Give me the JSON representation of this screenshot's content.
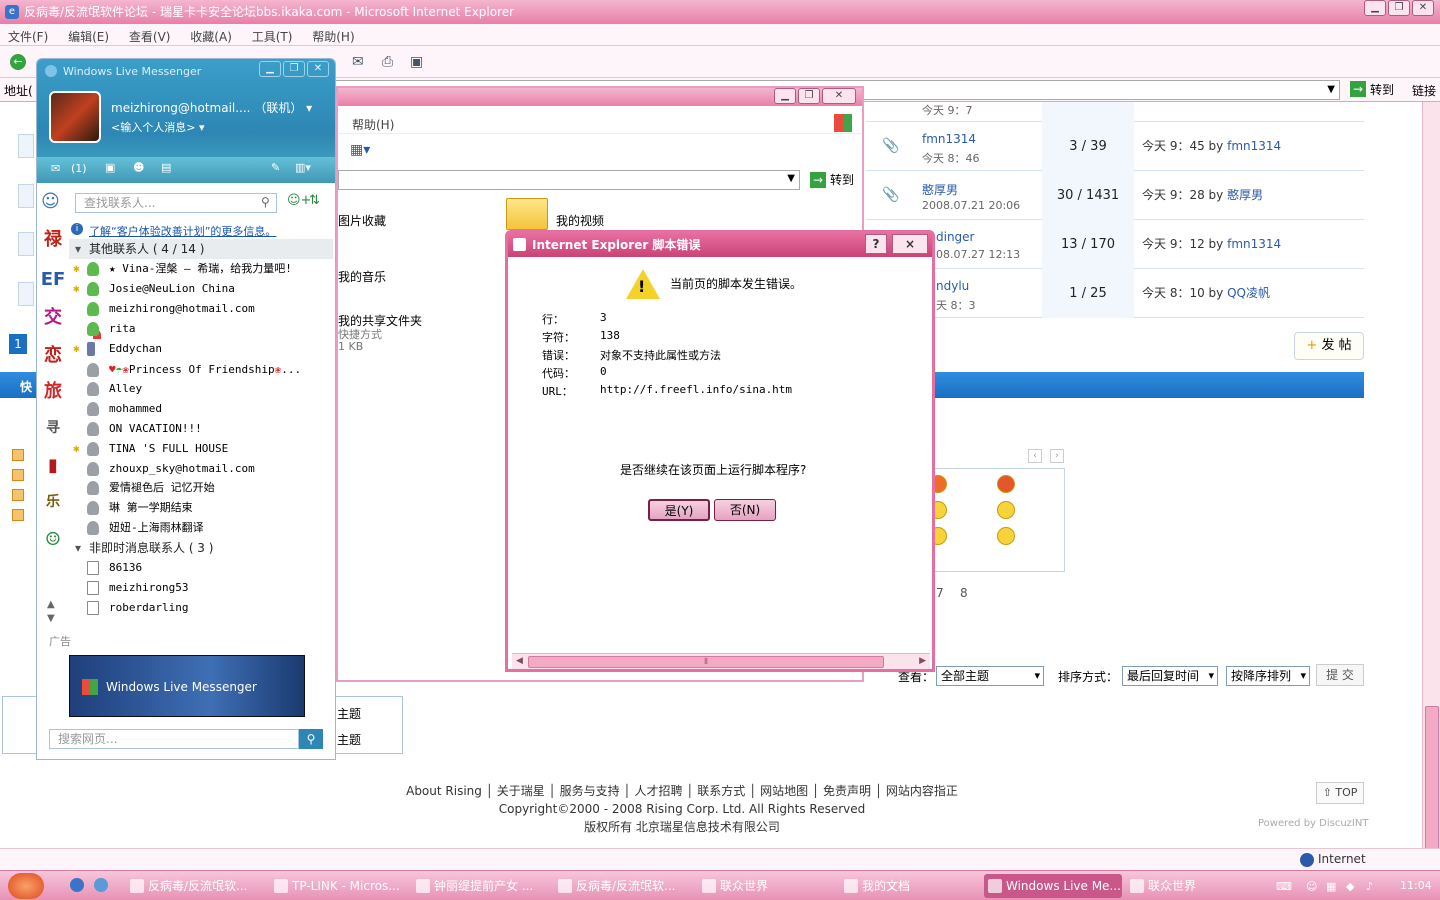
{
  "ie": {
    "title": "反病毒/反流氓软件论坛 - 瑞星卡卡安全论坛bbs.ikaka.com - Microsoft Internet Explorer",
    "menu": [
      "文件(F)",
      "编辑(E)",
      "查看(V)",
      "收藏(A)",
      "工具(T)",
      "帮助(H)"
    ],
    "address_label": "地址(",
    "go_label": "转到",
    "links_label": "链接",
    "status_zone": "Internet"
  },
  "forum": {
    "rows": [
      {
        "title": "",
        "date": "今天 9：7",
        "counts": "",
        "last": ""
      },
      {
        "title": "fmn1314",
        "date": "今天 8：46",
        "counts": "3 / 39",
        "last_time": "今天 9：45 by",
        "last_user": "fmn1314"
      },
      {
        "title": "憨厚男",
        "date": "2008.07.21 20:06",
        "counts": "30 / 1431",
        "last_time": "今天 9：28 by",
        "last_user": "憨厚男"
      },
      {
        "title": "dinger",
        "date": "08.07.27 12:13",
        "counts": "13 / 170",
        "last_time": "今天 9：12 by",
        "last_user": "fmn1314"
      },
      {
        "title": "ndylu",
        "date": "天 8：3",
        "counts": "1 / 25",
        "last_time": "今天 8：10 by",
        "last_user": "QQ凌帆"
      }
    ],
    "post_button": "发 帖",
    "page_one": "1",
    "bar_text": "快",
    "pages_tail": [
      "7",
      "8"
    ],
    "filter": {
      "view_label": "查看：",
      "view_value": "全部主题",
      "sort_label": "排序方式：",
      "sort_value": "最后回复时间",
      "order_value": "按降序排列",
      "submit": "提 交"
    },
    "footer_links": "About Rising │ 关于瑞星 │ 服务与支持 │ 人才招聘 │ 联系方式 │ 网站地图 │ 免责声明 │ 网站内容指正",
    "footer_copyright": "Copyright©2000 - 2008 Rising Corp. Ltd.  All Rights Reserved",
    "footer_owner": "版权所有 北京瑞星信息技术有限公司",
    "top_button": "TOP",
    "powered": "Powered by DiscuzINT",
    "topic_labels": [
      "主题",
      "主题"
    ]
  },
  "explorer": {
    "menu_help": "帮助(H)",
    "go_label": "转到",
    "items": [
      "图片收藏",
      "我的视频",
      "我的音乐",
      "我的共享文件夹"
    ],
    "shared_sub": "快捷方式",
    "shared_size": "1 KB"
  },
  "messenger": {
    "title": "Windows Live Messenger",
    "email": "meizhirong@hotmail....",
    "status": "（联机）",
    "psm": "<输入个人消息>",
    "mail_count": "(1)",
    "search_placeholder": "查找联系人...",
    "improve_link": "了解“客户体验改善计划”的更多信息。",
    "group_other": "其他联系人 ( 4 / 14 )",
    "group_offline": "非即时消息联系人 ( 3 )",
    "contacts": [
      "★ Vina-涅槃  —  希瑞，给我力量吧!",
      "Josie@NeuLion China",
      "meizhirong@hotmail.com",
      "rita",
      "Eddychan",
      "Princess Of Friendship",
      "Alley",
      "mohammed",
      "ON VACATION!!!",
      "TINA 'S  FULL HOUSE",
      "zhouxp_sky@hotmail.com",
      "爱情褪色后 记忆开始",
      "琳 第一学期结束",
      "妞妞-上海雨林翻译"
    ],
    "offline_contacts": [
      "86136",
      "meizhirong53",
      "roberdarling"
    ],
    "ad_label": "广告",
    "ad_text": "Windows Live Messenger",
    "web_search_placeholder": "搜索网页..."
  },
  "dialog": {
    "title": "Internet Explorer 脚本错误",
    "message": "当前页的脚本发生错误。",
    "line_label": "行：",
    "line_value": "3",
    "char_label": "字符：",
    "char_value": "138",
    "error_label": "错误：",
    "error_value": "对象不支持此属性或方法",
    "code_label": "代码：",
    "code_value": "0",
    "url_label": "URL：",
    "url_value": "http://f.freefl.info/sina.htm",
    "question": "是否继续在该页面上运行脚本程序?",
    "yes": "是(Y)",
    "no": "否(N)",
    "help": "?",
    "close": "×"
  },
  "taskbar": {
    "tasks": [
      "反病毒/反流氓软...",
      "TP-LINK - Micros...",
      "钟丽缇提前产女 ...",
      "反病毒/反流氓软...",
      "联众世界",
      "我的文档",
      "Windows Live Me...",
      "联众世界"
    ],
    "clock": "11:04"
  }
}
